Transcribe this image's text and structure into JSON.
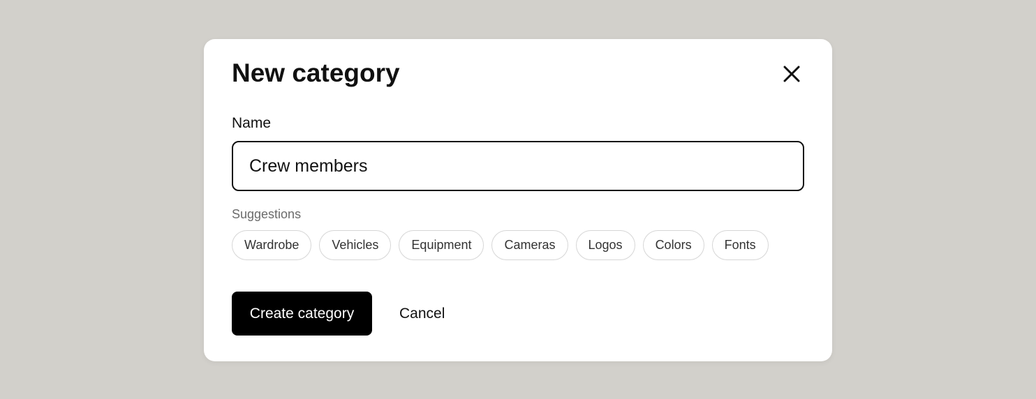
{
  "dialog": {
    "title": "New category",
    "close_icon": "close-icon",
    "name_label": "Name",
    "name_value": "Crew members",
    "suggestions_label": "Suggestions",
    "suggestions": [
      "Wardrobe",
      "Vehicles",
      "Equipment",
      "Cameras",
      "Logos",
      "Colors",
      "Fonts"
    ],
    "create_label": "Create category",
    "cancel_label": "Cancel"
  },
  "colors": {
    "backdrop": "#d2d0cb",
    "dialog_background": "#ffffff",
    "primary_button": "#000000",
    "primary_button_text": "#ffffff",
    "input_border": "#111111",
    "chip_border": "#d6d6d6",
    "muted_text": "#6b6b6b"
  }
}
